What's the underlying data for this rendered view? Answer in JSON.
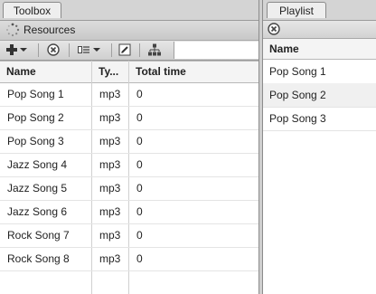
{
  "left_panel": {
    "tab_label": "Toolbox",
    "section_title": "Resources",
    "toolbar_icons": [
      "add-icon",
      "dropdown-arrow-icon",
      "remove-icon",
      "view-mode-icon",
      "dropdown-arrow-icon",
      "edit-icon",
      "hierarchy-icon"
    ],
    "columns": [
      "Name",
      "Ty...",
      "Total time"
    ],
    "rows": [
      {
        "name": "Pop Song 1",
        "type": "mp3",
        "total_time": "0"
      },
      {
        "name": "Pop Song 2",
        "type": "mp3",
        "total_time": "0"
      },
      {
        "name": "Pop Song 3",
        "type": "mp3",
        "total_time": "0"
      },
      {
        "name": "Jazz Song 4",
        "type": "mp3",
        "total_time": "0"
      },
      {
        "name": "Jazz Song 5",
        "type": "mp3",
        "total_time": "0"
      },
      {
        "name": "Jazz Song 6",
        "type": "mp3",
        "total_time": "0"
      },
      {
        "name": "Rock Song 7",
        "type": "mp3",
        "total_time": "0"
      },
      {
        "name": "Rock Song 8",
        "type": "mp3",
        "total_time": "0"
      }
    ]
  },
  "right_panel": {
    "tab_label": "Playlist",
    "columns": [
      "Name"
    ],
    "rows": [
      {
        "name": "Pop Song 1"
      },
      {
        "name": "Pop Song 2"
      },
      {
        "name": "Pop Song 3"
      }
    ]
  }
}
